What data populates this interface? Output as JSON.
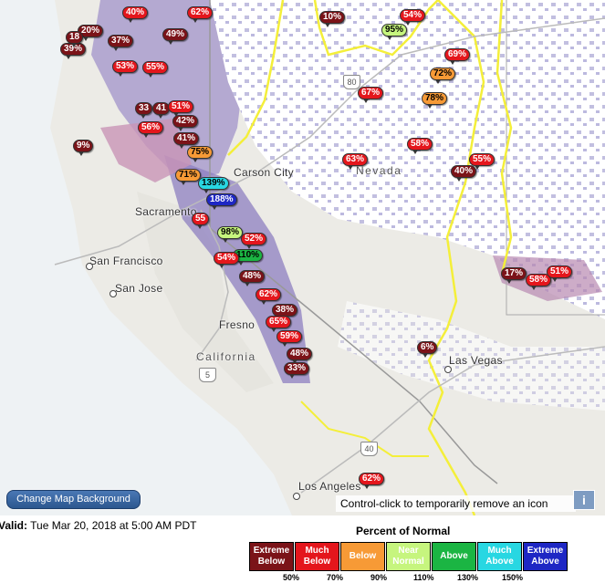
{
  "map": {
    "cities": [
      {
        "id": "carson-city",
        "name": "Carson City"
      },
      {
        "id": "sacramento",
        "name": "Sacramento"
      },
      {
        "id": "san-francisco",
        "name": "San Francisco"
      },
      {
        "id": "san-jose",
        "name": "San Jose"
      },
      {
        "id": "fresno",
        "name": "Fresno"
      },
      {
        "id": "las-vegas",
        "name": "Las Vegas"
      },
      {
        "id": "los-angeles",
        "name": "Los Angeles"
      }
    ],
    "states": [
      {
        "id": "california",
        "name": "California"
      },
      {
        "id": "nevada",
        "name": "Nevada"
      }
    ],
    "highways": [
      {
        "id": "i80",
        "label": "80"
      },
      {
        "id": "i5",
        "label": "5"
      },
      {
        "id": "i40",
        "label": "40"
      }
    ],
    "markers": [
      {
        "label": "40%",
        "cat": "much-below"
      },
      {
        "label": "62%",
        "cat": "much-below"
      },
      {
        "label": "10%",
        "cat": "extreme-below"
      },
      {
        "label": "54%",
        "cat": "much-below"
      },
      {
        "label": "95%",
        "cat": "near-normal"
      },
      {
        "label": "20%",
        "cat": "extreme-below"
      },
      {
        "label": "37%",
        "cat": "extreme-below"
      },
      {
        "label": "49%",
        "cat": "extreme-below"
      },
      {
        "label": "39%",
        "cat": "extreme-below"
      },
      {
        "label": "53%",
        "cat": "much-below"
      },
      {
        "label": "55%",
        "cat": "much-below"
      },
      {
        "label": "69%",
        "cat": "much-below"
      },
      {
        "label": "72%",
        "cat": "below"
      },
      {
        "label": "67%",
        "cat": "much-below"
      },
      {
        "label": "78%",
        "cat": "below"
      },
      {
        "label": "33",
        "cat": "extreme-below"
      },
      {
        "label": "41",
        "cat": "extreme-below"
      },
      {
        "label": "51%",
        "cat": "much-below"
      },
      {
        "label": "42%",
        "cat": "extreme-below"
      },
      {
        "label": "56%",
        "cat": "much-below"
      },
      {
        "label": "41%",
        "cat": "extreme-below"
      },
      {
        "label": "9%",
        "cat": "extreme-below"
      },
      {
        "label": "58%",
        "cat": "much-below"
      },
      {
        "label": "75%",
        "cat": "below"
      },
      {
        "label": "63%",
        "cat": "much-below"
      },
      {
        "label": "55%",
        "cat": "much-below"
      },
      {
        "label": "40%",
        "cat": "extreme-below"
      },
      {
        "label": "71%",
        "cat": "below"
      },
      {
        "label": "139%",
        "cat": "much-above"
      },
      {
        "label": "188%",
        "cat": "extreme-above"
      },
      {
        "label": "55",
        "cat": "much-below"
      },
      {
        "label": "98%",
        "cat": "near-normal"
      },
      {
        "label": "52%",
        "cat": "much-below"
      },
      {
        "label": "110%",
        "cat": "above"
      },
      {
        "label": "54%",
        "cat": "much-below"
      },
      {
        "label": "17%",
        "cat": "extreme-below"
      },
      {
        "label": "58%",
        "cat": "much-below"
      },
      {
        "label": "51%",
        "cat": "much-below"
      },
      {
        "label": "48%",
        "cat": "extreme-below"
      },
      {
        "label": "62%",
        "cat": "much-below"
      },
      {
        "label": "38%",
        "cat": "extreme-below"
      },
      {
        "label": "65%",
        "cat": "much-below"
      },
      {
        "label": "59%",
        "cat": "much-below"
      },
      {
        "label": "48%",
        "cat": "extreme-below"
      },
      {
        "label": "33%",
        "cat": "extreme-below"
      },
      {
        "label": "6%",
        "cat": "extreme-below"
      },
      {
        "label": "62%",
        "cat": "much-below"
      },
      {
        "label": "18",
        "cat": "extreme-below"
      }
    ],
    "change_bg_label": "Change Map Background",
    "ctrl_hint": "Control-click to temporarily remove an icon",
    "info_label": "i"
  },
  "footer": {
    "valid_label": "Valid:",
    "valid_value": " Tue Mar 20, 2018 at 5:00 AM PDT",
    "legend_title": "Percent of Normal",
    "legend": [
      {
        "label": "Extreme\nBelow",
        "color": "#7b1318",
        "text": "#ffffff"
      },
      {
        "label": "Much\nBelow",
        "color": "#e4161c",
        "text": "#ffffff"
      },
      {
        "label": "Below",
        "color": "#f79a36",
        "text": "#ffffff"
      },
      {
        "label": "Near\nNormal",
        "color": "#c6f57e",
        "text": "#ffffff"
      },
      {
        "label": "Above",
        "color": "#1bb543",
        "text": "#ffffff"
      },
      {
        "label": "Much\nAbove",
        "color": "#28d7e2",
        "text": "#ffffff"
      },
      {
        "label": "Extreme\nAbove",
        "color": "#1e27c4",
        "text": "#ffffff"
      }
    ],
    "ticks": [
      "50%",
      "70%",
      "90%",
      "110%",
      "130%",
      "150%"
    ]
  }
}
